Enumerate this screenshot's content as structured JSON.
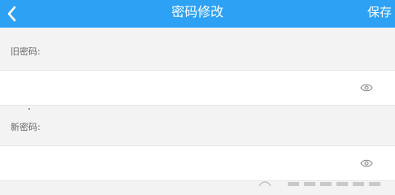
{
  "navbar": {
    "title": "密码修改",
    "save_label": "保存",
    "back_icon": "chevron-left-icon",
    "background": "#2da1f3"
  },
  "form": {
    "old_password": {
      "label": "旧密码:",
      "value": "",
      "visibility_icon": "eye-icon"
    },
    "new_password": {
      "label": "新密码:",
      "value": "",
      "visibility_icon": "eye-icon"
    }
  }
}
